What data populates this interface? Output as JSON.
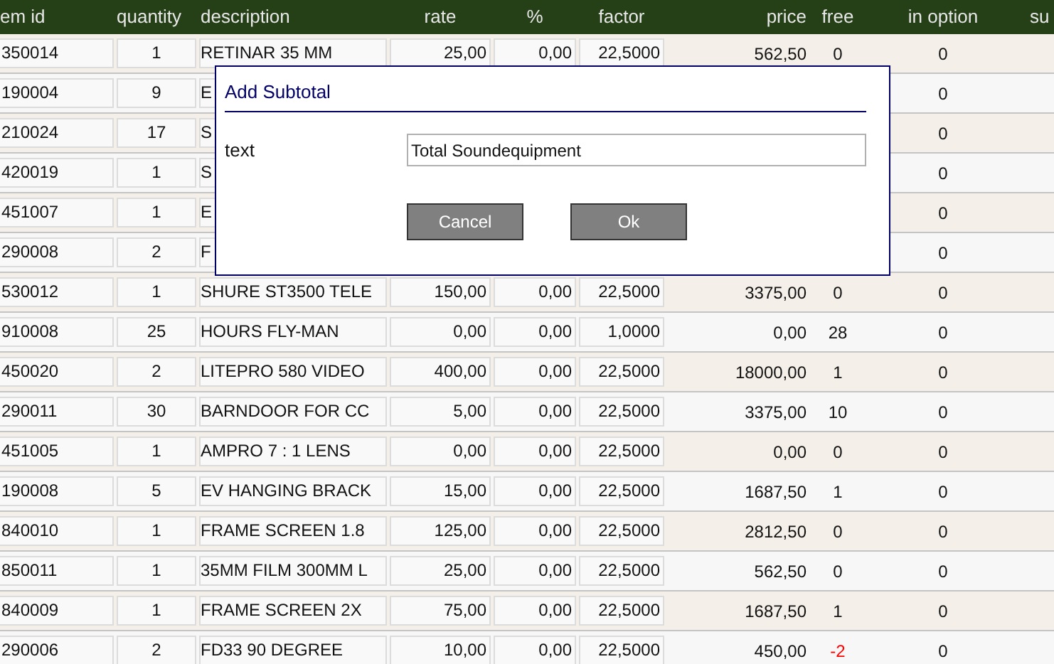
{
  "columns": [
    "em id",
    "quantity",
    "description",
    "rate",
    "%",
    "factor",
    "price",
    "free",
    "in option",
    "su"
  ],
  "rows": [
    {
      "id": "350014",
      "quantity": "1",
      "description": "RETINAR 35 MM",
      "rate": "25,00",
      "pct": "0,00",
      "factor": "22,5000",
      "price": "562,50",
      "free": "0",
      "free_alert": false,
      "in_option": "0"
    },
    {
      "id": "190004",
      "quantity": "9",
      "description": "E",
      "in_option": "0"
    },
    {
      "id": "210024",
      "quantity": "17",
      "description": "S",
      "in_option": "0"
    },
    {
      "id": "420019",
      "quantity": "1",
      "description": "S",
      "in_option": "0"
    },
    {
      "id": "451007",
      "quantity": "1",
      "description": "E",
      "in_option": "0"
    },
    {
      "id": "290008",
      "quantity": "2",
      "description": "F",
      "in_option": "0"
    },
    {
      "id": "530012",
      "quantity": "1",
      "description": "SHURE ST3500 TELE",
      "rate": "150,00",
      "pct": "0,00",
      "factor": "22,5000",
      "price": "3375,00",
      "free": "0",
      "free_alert": false,
      "in_option": "0"
    },
    {
      "id": "910008",
      "quantity": "25",
      "description": "HOURS FLY-MAN",
      "rate": "0,00",
      "pct": "0,00",
      "factor": "1,0000",
      "price": "0,00",
      "free": "28",
      "free_alert": false,
      "in_option": "0"
    },
    {
      "id": "450020",
      "quantity": "2",
      "description": "LITEPRO 580 VIDEO",
      "rate": "400,00",
      "pct": "0,00",
      "factor": "22,5000",
      "price": "18000,00",
      "free": "1",
      "free_alert": false,
      "in_option": "0"
    },
    {
      "id": "290011",
      "quantity": "30",
      "description": "BARNDOOR FOR CC",
      "rate": "5,00",
      "pct": "0,00",
      "factor": "22,5000",
      "price": "3375,00",
      "free": "10",
      "free_alert": false,
      "in_option": "0"
    },
    {
      "id": "451005",
      "quantity": "1",
      "description": "AMPRO 7 : 1 LENS",
      "rate": "0,00",
      "pct": "0,00",
      "factor": "22,5000",
      "price": "0,00",
      "free": "0",
      "free_alert": false,
      "in_option": "0"
    },
    {
      "id": "190008",
      "quantity": "5",
      "description": "EV HANGING BRACK",
      "rate": "15,00",
      "pct": "0,00",
      "factor": "22,5000",
      "price": "1687,50",
      "free": "1",
      "free_alert": false,
      "in_option": "0"
    },
    {
      "id": "840010",
      "quantity": "1",
      "description": "FRAME SCREEN 1.8",
      "rate": "125,00",
      "pct": "0,00",
      "factor": "22,5000",
      "price": "2812,50",
      "free": "0",
      "free_alert": false,
      "in_option": "0"
    },
    {
      "id": "850011",
      "quantity": "1",
      "description": "35MM FILM 300MM L",
      "rate": "25,00",
      "pct": "0,00",
      "factor": "22,5000",
      "price": "562,50",
      "free": "0",
      "free_alert": false,
      "in_option": "0"
    },
    {
      "id": "840009",
      "quantity": "1",
      "description": "FRAME SCREEN 2X",
      "rate": "75,00",
      "pct": "0,00",
      "factor": "22,5000",
      "price": "1687,50",
      "free": "1",
      "free_alert": false,
      "in_option": "0"
    },
    {
      "id": "290006",
      "quantity": "2",
      "description": "FD33 90 DEGREE",
      "rate": "10,00",
      "pct": "0,00",
      "factor": "22,5000",
      "price": "450,00",
      "free": "-2",
      "free_alert": true,
      "in_option": "0"
    }
  ],
  "dialog": {
    "title": "Add Subtotal",
    "label": "text",
    "value": "Total Soundequipment",
    "buttons": [
      "Cancel",
      "Ok"
    ]
  }
}
